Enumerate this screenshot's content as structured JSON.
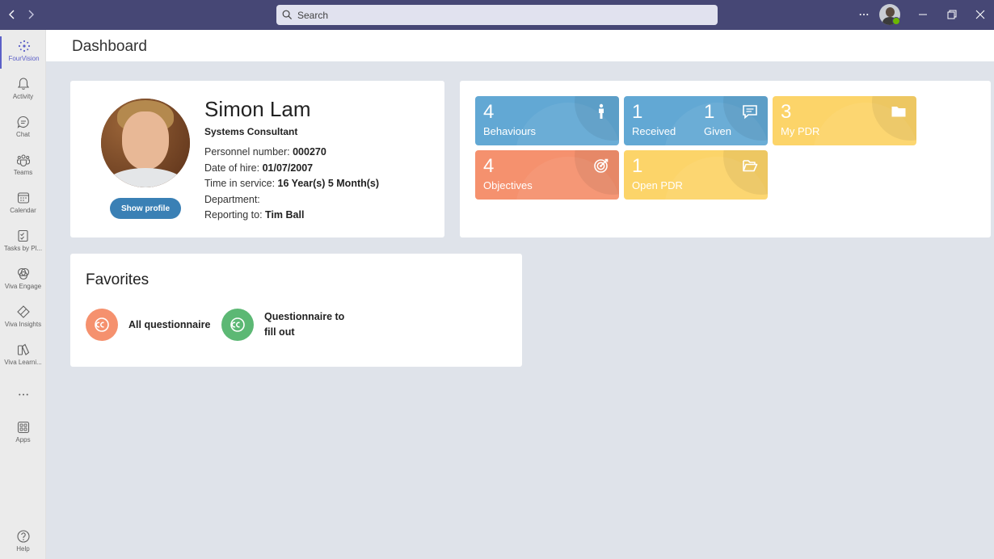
{
  "search": {
    "placeholder": "Search"
  },
  "rail": {
    "items": [
      {
        "label": "FourVision",
        "icon": "fourvision-icon"
      },
      {
        "label": "Activity",
        "icon": "bell-icon"
      },
      {
        "label": "Chat",
        "icon": "chat-icon"
      },
      {
        "label": "Teams",
        "icon": "teams-icon"
      },
      {
        "label": "Calendar",
        "icon": "calendar-icon"
      },
      {
        "label": "Tasks by Pl...",
        "icon": "tasks-icon"
      },
      {
        "label": "Viva Engage",
        "icon": "viva-engage-icon"
      },
      {
        "label": "Viva Insights",
        "icon": "viva-insights-icon"
      },
      {
        "label": "Viva Learni...",
        "icon": "viva-learning-icon"
      },
      {
        "label": "Apps",
        "icon": "apps-icon"
      },
      {
        "label": "Help",
        "icon": "help-icon"
      }
    ]
  },
  "header": {
    "title": "Dashboard"
  },
  "profile": {
    "name": "Simon Lam",
    "job_title": "Systems Consultant",
    "show_profile_label": "Show profile",
    "fields": [
      {
        "label": "Personnel number: ",
        "value": "000270"
      },
      {
        "label": "Date of hire: ",
        "value": "01/07/2007"
      },
      {
        "label": "Time in service: ",
        "value": "16 Year(s) 5 Month(s)"
      },
      {
        "label": "Department:",
        "value": ""
      },
      {
        "label": "Reporting to: ",
        "value": "Tim Ball"
      }
    ]
  },
  "tiles": {
    "behaviours": {
      "count": "4",
      "label": "Behaviours",
      "icon": "person-icon",
      "color": "#62a8d4"
    },
    "feedback": {
      "received_count": "1",
      "received_label": "Received",
      "given_count": "1",
      "given_label": "Given",
      "icon": "comment-icon",
      "color": "#62a8d4"
    },
    "my_pdr": {
      "count": "3",
      "label": "My PDR",
      "icon": "folder-icon",
      "color": "#fcd469"
    },
    "objectives": {
      "count": "4",
      "label": "Objectives",
      "icon": "target-icon",
      "color": "#f5916e"
    },
    "open_pdr": {
      "count": "1",
      "label": "Open PDR",
      "icon": "folder-open-icon",
      "color": "#fcd469"
    }
  },
  "favorites": {
    "title": "Favorites",
    "items": [
      {
        "label": "All questionnaire",
        "color": "#f5916e"
      },
      {
        "label_line1": "Questionnaire to",
        "label_line2": "fill out",
        "color": "#5cb874"
      }
    ]
  }
}
